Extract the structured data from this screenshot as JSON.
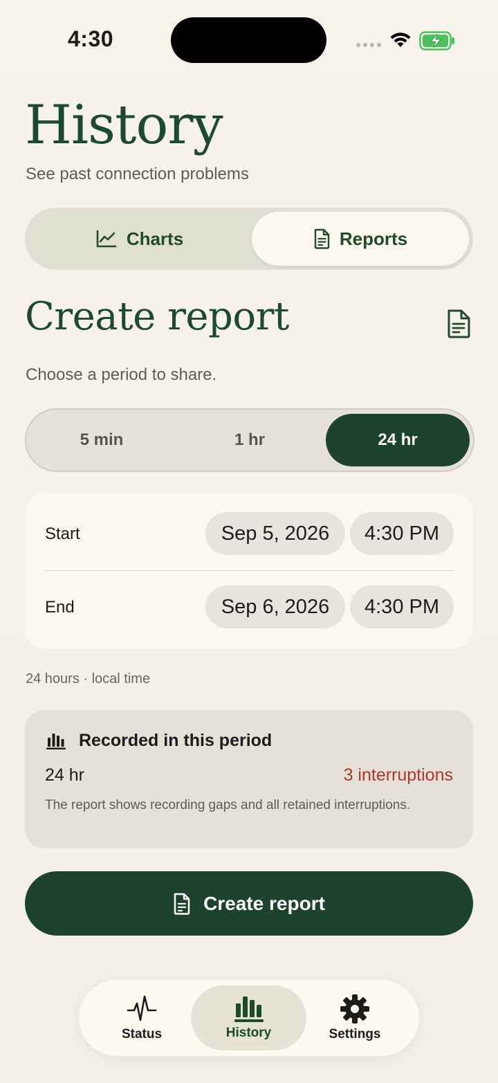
{
  "status_bar": {
    "time": "4:30"
  },
  "header": {
    "title": "History",
    "subtitle": "See past connection problems"
  },
  "tabs": [
    {
      "label": "Charts",
      "icon": "line-chart-icon",
      "selected": false
    },
    {
      "label": "Reports",
      "icon": "document-icon",
      "selected": true
    }
  ],
  "section": {
    "title": "Create report",
    "hint": "Choose a period to share."
  },
  "period_options": [
    {
      "label": "5 min",
      "selected": false
    },
    {
      "label": "1 hr",
      "selected": false
    },
    {
      "label": "24 hr",
      "selected": true
    }
  ],
  "range": {
    "start_label": "Start",
    "start_date": "Sep 5, 2026",
    "start_time": "4:30 PM",
    "end_label": "End",
    "end_date": "Sep 6, 2026",
    "end_time": "4:30 PM",
    "note": "24 hours · local time"
  },
  "recorded": {
    "title": "Recorded in this period",
    "duration": "24 hr",
    "interruptions": "3 interruptions",
    "description": "The report shows recording gaps and all retained interruptions."
  },
  "create_button": {
    "label": "Create report"
  },
  "nav": [
    {
      "label": "Status",
      "icon": "pulse-icon",
      "selected": false
    },
    {
      "label": "History",
      "icon": "bar-chart-icon",
      "selected": true
    },
    {
      "label": "Settings",
      "icon": "gear-icon",
      "selected": false
    }
  ],
  "colors": {
    "brand": "#1c432b",
    "accent_red": "#b3332f",
    "background": "#f6f3ea"
  }
}
